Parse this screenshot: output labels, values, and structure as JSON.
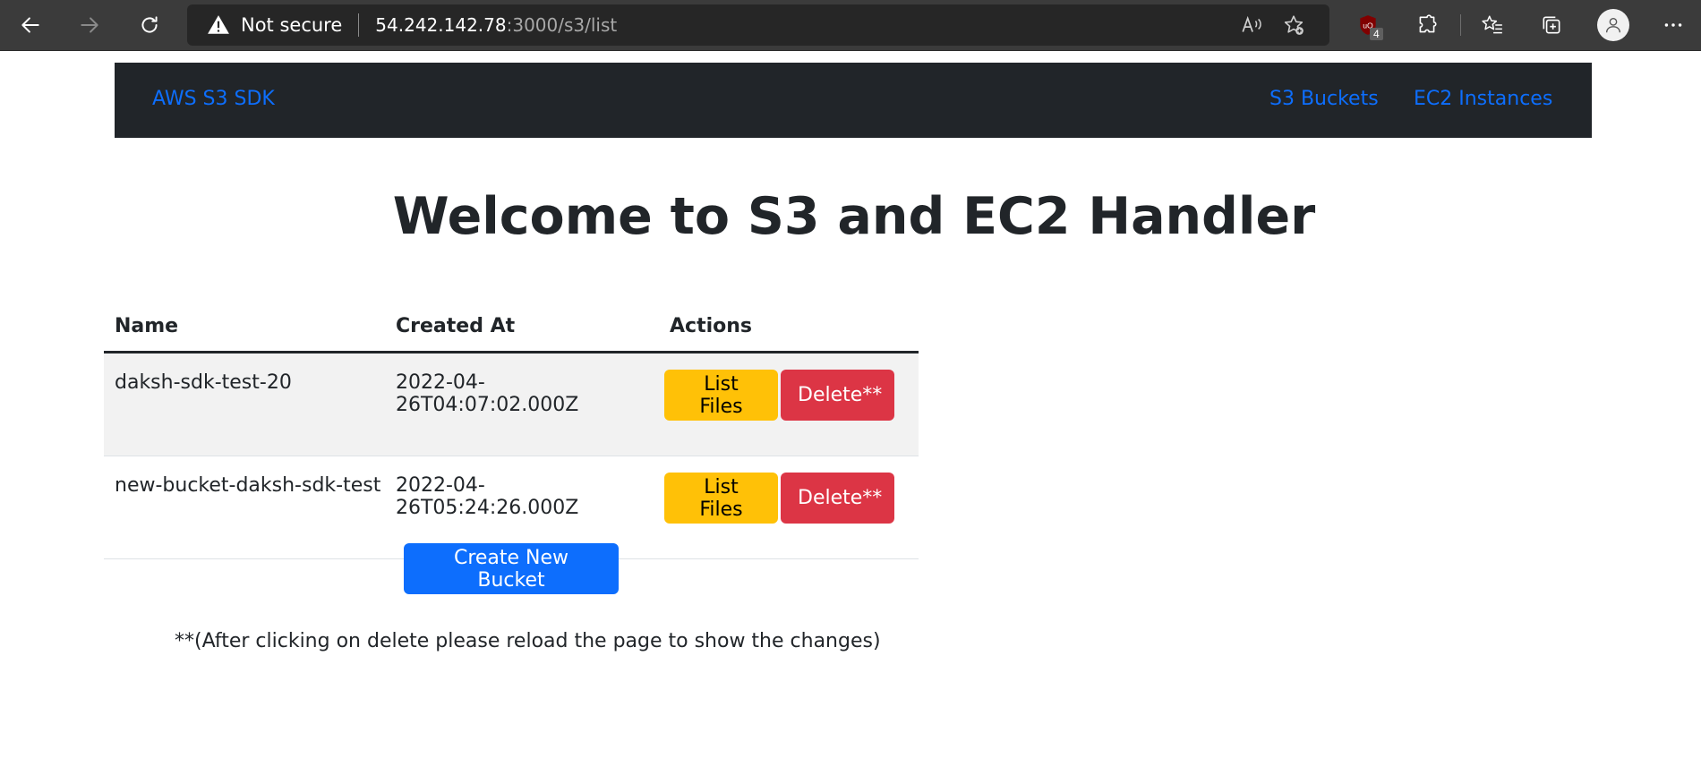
{
  "browser": {
    "security_label": "Not secure",
    "url_host": "54.242.142.78",
    "url_rest": ":3000/s3/list",
    "extension_badge": "4",
    "icons": [
      "back-icon",
      "forward-icon",
      "refresh-icon",
      "warning-icon",
      "read-aloud-icon",
      "add-favorite-icon",
      "ublock-icon",
      "extensions-icon",
      "favorites-icon",
      "collections-icon",
      "profile-icon",
      "more-icon"
    ]
  },
  "navbar": {
    "brand": "AWS S3 SDK",
    "links": [
      "S3 Buckets",
      "EC2 Instances"
    ]
  },
  "page": {
    "title": "Welcome to S3 and EC2 Handler",
    "table": {
      "headers": [
        "Name",
        "Created At",
        "Actions"
      ],
      "rows": [
        {
          "name": "daksh-sdk-test-20",
          "created_at": "2022-04-26T04:07:02.000Z",
          "list_label": "List Files",
          "delete_label": "Delete**"
        },
        {
          "name": "new-bucket-daksh-sdk-test",
          "created_at": "2022-04-26T05:24:26.000Z",
          "list_label": "List Files",
          "delete_label": "Delete**"
        }
      ]
    },
    "create_button": "Create New Bucket",
    "note": "**(After clicking on delete please reload the page to show the changes)"
  },
  "colors": {
    "primary": "#0d6efd",
    "warning": "#ffc107",
    "danger": "#dc3545",
    "navbar_bg": "#212529",
    "browser_bg": "#3b3b3b"
  }
}
